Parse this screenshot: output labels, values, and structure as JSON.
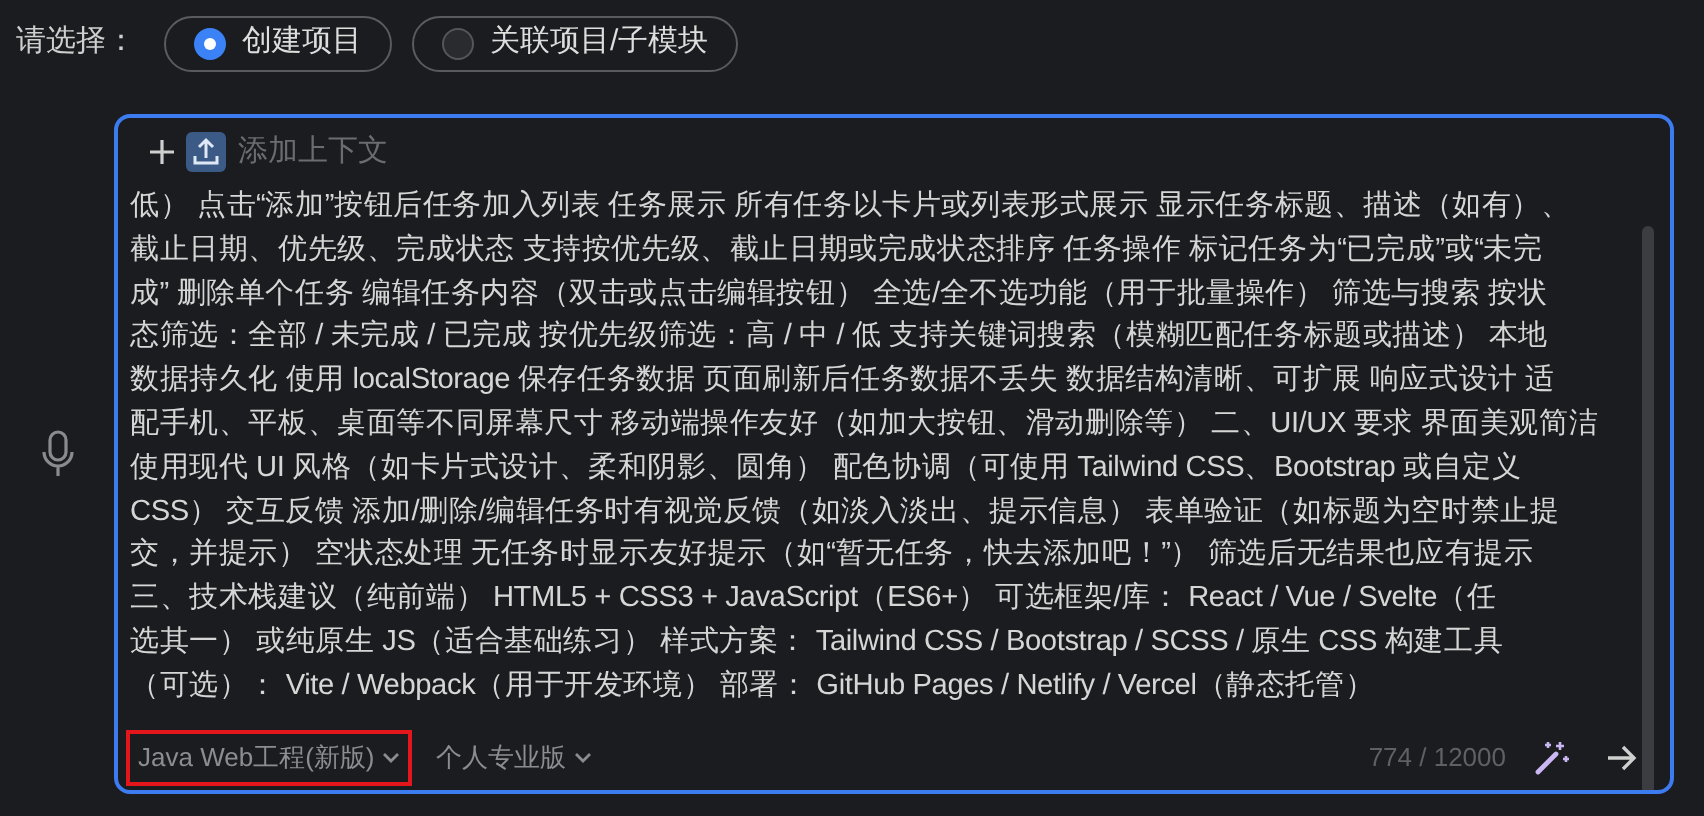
{
  "prompt_label": "请选择：",
  "options": [
    {
      "label": "创建项目",
      "selected": true
    },
    {
      "label": "关联项目/子模块",
      "selected": false
    }
  ],
  "context": {
    "label": "添加上下文"
  },
  "text_lines": [
    "低） 点击“添加”按钮后任务加入列表 任务展示 所有任务以卡片或列表形式展示 显示任务标题、描述（如有）、",
    "截止日期、优先级、完成状态 支持按优先级、截止日期或完成状态排序 任务操作  标记任务为“已完成”或“未完",
    "成” 删除单个任务  编辑任务内容（双击或点击编辑按钮） 全选/全不选功能（用于批量操作） 筛选与搜索 按状",
    "态筛选：全部 / 未完成 / 已完成 按优先级筛选：高 / 中 / 低 支持关键词搜索（模糊匹配任务标题或描述） 本地",
    "数据持久化 使用 localStorage 保存任务数据 页面刷新后任务数据不丢失 数据结构清晰、可扩展 响应式设计 适",
    "配手机、平板、桌面等不同屏幕尺寸 移动端操作友好（如加大按钮、滑动删除等） 二、UI/UX 要求 界面美观简洁",
    "使用现代 UI 风格（如卡片式设计、柔和阴影、圆角） 配色协调（可使用 Tailwind CSS、Bootstrap 或自定义",
    "CSS） 交互反馈 添加/删除/编辑任务时有视觉反馈（如淡入淡出、提示信息） 表单验证（如标题为空时禁止提",
    "交，并提示） 空状态处理 无任务时显示友好提示（如“暂无任务，快去添加吧！”） 筛选后无结果也应有提示",
    "三、技术栈建议（纯前端） HTML5 + CSS3 + JavaScript（ES6+） 可选框架/库： React / Vue / Svelte（任",
    "选其一） 或纯原生 JS（适合基础练习） 样式方案： Tailwind CSS / Bootstrap / SCSS / 原生 CSS 构建工具",
    "（可选）： Vite / Webpack（用于开发环境） 部署： GitHub Pages / Netlify / Vercel（静态托管）"
  ],
  "footer": {
    "project_type": {
      "label": "Java Web工程(新版)",
      "highlighted": true
    },
    "edition": {
      "label": "个人专业版"
    },
    "counter": "774 / 12000"
  }
}
